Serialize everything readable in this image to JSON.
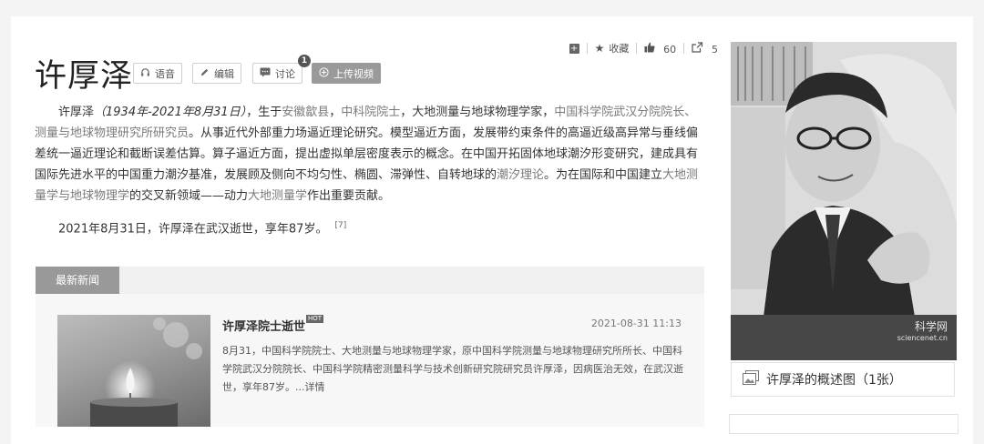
{
  "title": "许厚泽",
  "toolbar": {
    "voice": "语音",
    "edit": "编辑",
    "discuss": "讨论",
    "discuss_badge": "1",
    "upload": "上传视频"
  },
  "actions": {
    "favorite": "收藏",
    "likes": "60",
    "shares": "5"
  },
  "intro": {
    "name": "许厚泽",
    "dates": "（1934年-2021年8月31日）",
    "t1": "，生于",
    "l1": "安徽歙县",
    "t2": "，",
    "l2": "中科院院士",
    "t3": "，大地测量与地球物理学家，",
    "l3": "中国科学院武汉分院院长、测量与地球物理研究所研究员",
    "t4": "。从事近代外部重力场逼近理论研究。模型逼近方面，发展带约束条件的高逼近级高异常与垂线偏差统一逼近理论和截断误差估算。算子逼近方面，提出虚拟单层密度表示的概念。在中国开拓固体地球潮汐形变研究，建成具有国际先进水平的中国重力潮汐基准，发展顾及侧向不均匀性、椭圆、滞弹性、自转地球的",
    "l4": "潮汐理论",
    "t5": "。为在国际和中国建立",
    "l5": "大地测量学与地球物理学",
    "t6": "的交叉新领域——动力",
    "l6": "大地测量学",
    "t7": "作出重要贡献。"
  },
  "death": {
    "text": "2021年8月31日，许厚泽在武汉逝世，享年87岁。",
    "ref": "[7]"
  },
  "news": {
    "tab": "最新新闻",
    "items": [
      {
        "title": "许厚泽院士逝世",
        "hot": "HOT",
        "date": "2021-08-31 11:13",
        "desc": "8月31，中国科学院院士、大地测量与地球物理学家，原中国科学院测量与地球物理研究所所长、中国科学院武汉分院院长、中国科学院精密测量科学与技术创新研究院研究员许厚泽，因病医治无效，在武汉逝世，享年87岁。...详情"
      }
    ]
  },
  "sidebar": {
    "photo_watermark": "科学网",
    "photo_watermark_sub": "sciencenet.cn",
    "caption": "许厚泽的概述图（1张）"
  },
  "icons": {
    "headphones": "headphones-icon",
    "pencil": "pencil-icon",
    "comment": "comment-icon",
    "plus-circle": "plus-circle-icon",
    "plus-box": "plus-box-icon",
    "star": "star-icon",
    "thumb-up": "thumb-up-icon",
    "share": "share-icon",
    "gallery": "gallery-icon"
  }
}
